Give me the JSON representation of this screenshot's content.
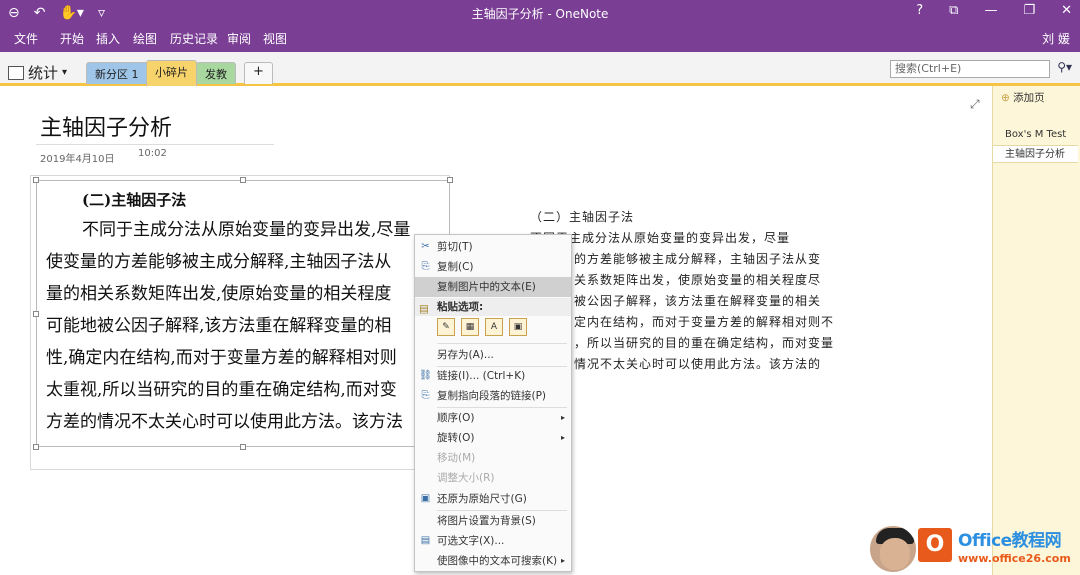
{
  "window": {
    "title": "主轴因子分析 - OneNote",
    "controls": [
      "?",
      "⧉",
      "—",
      "❐",
      "✕"
    ]
  },
  "ribbon": {
    "tabs": [
      "文件",
      "开始",
      "插入",
      "绘图",
      "历史记录",
      "审阅",
      "视图"
    ],
    "user": "刘 媛"
  },
  "notebook": {
    "name": "统计"
  },
  "sections": [
    {
      "label": "新分区 1",
      "color": "#9fc5e8"
    },
    {
      "label": "小碎片",
      "color": "#f6d36b"
    },
    {
      "label": "发教",
      "color": "#a8d8a0"
    },
    {
      "label": "+",
      "color": "#f3f3f3"
    }
  ],
  "search": {
    "placeholder": "搜索(Ctrl+E)"
  },
  "page": {
    "title": "主轴因子分析",
    "date": "2019年4月10日",
    "time": "10:02"
  },
  "image_text": {
    "heading": "(二)主轴因子法",
    "lines": [
      "不同于主成分法从原始变量的变异出发,尽量",
      "使变量的方差能够被主成分解释,主轴因子法从",
      "量的相关系数矩阵出发,使原始变量的相关程度",
      "可能地被公因子解释,该方法重在解释变量的相",
      "性,确定内在结构,而对于变量方差的解释相对则",
      "太重视,所以当研究的目的重在确定结构,而对变",
      "方差的情况不太关心时可以使用此方法。该方法"
    ]
  },
  "right_text": [
    "（二）主轴因子法",
    "不同于主成分法从原始变量的变异出发，尽量",
    "的方差能够被主成分解释，主轴因子法从变",
    "关系数矩阵出发，使原始变量的相关程度尽",
    "被公因子解释，该方法重在解释变量的相关",
    "定内在结构，而对于变量方差的解释相对则不",
    "，所以当研究的目的重在确定结构，而对变量",
    "情况不太关心时可以使用此方法。该方法的"
  ],
  "context_menu": {
    "cut": "剪切(T)",
    "copy": "复制(C)",
    "copy_text": "复制图片中的文本(E)",
    "paste_options": "粘贴选项:",
    "save_as": "另存为(A)...",
    "link": "链接(I)...  (Ctrl+K)",
    "copy_link": "复制指向段落的链接(P)",
    "order": "顺序(O)",
    "rotate": "旋转(O)",
    "move": "移动(M)",
    "resize": "调整大小(R)",
    "restore": "还原为原始尺寸(G)",
    "set_bg": "将图片设置为背景(S)",
    "alt_text": "可选文字(X)...",
    "searchable": "使图像中的文本可搜索(K)"
  },
  "pages_pane": {
    "add_page": "添加页",
    "items": [
      "Box's M Test",
      "主轴因子分析"
    ]
  },
  "watermark": {
    "text1": "Office教程网",
    "text2": "www.office26.com",
    "logo_letter": "O"
  }
}
